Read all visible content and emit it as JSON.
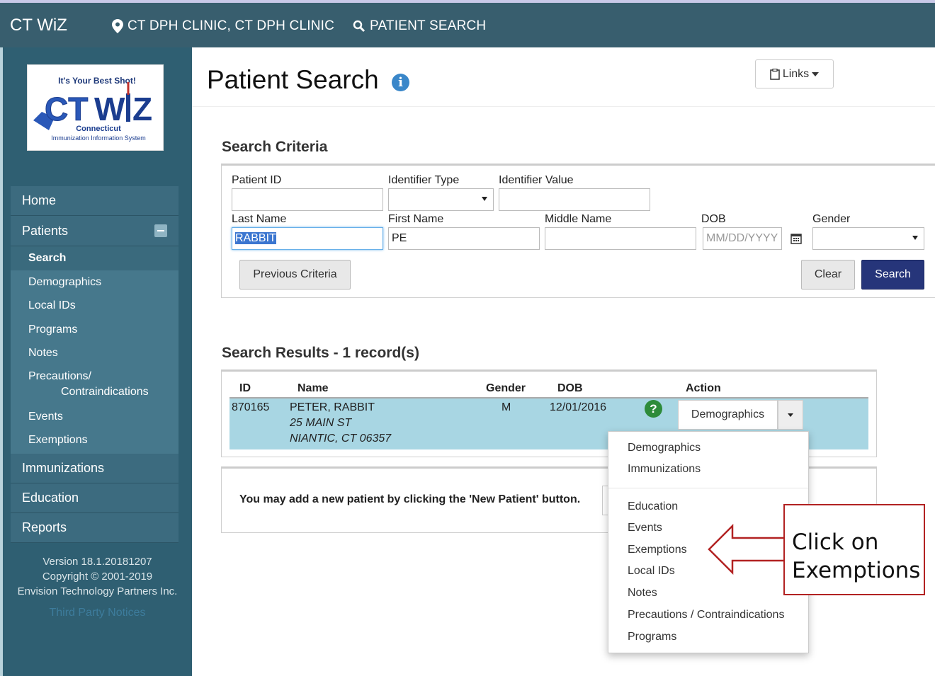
{
  "topbar": {
    "brand": "CT WiZ",
    "clinic": "CT DPH CLINIC, CT DPH CLINIC",
    "page": "PATIENT SEARCH",
    "clinic_icon": "map-marker-icon",
    "page_icon": "search-icon"
  },
  "logo": {
    "tagline": "It's Your Best Shot!",
    "wordmark": "CT WiZ",
    "state": "Connecticut",
    "system": "Immunization Information System"
  },
  "sidebar": {
    "home": "Home",
    "patients": "Patients",
    "patient_items": [
      "Search",
      "Demographics",
      "Local IDs",
      "Programs",
      "Notes"
    ],
    "precautions_line1": "Precautions/",
    "precautions_line2": "Contraindications",
    "patient_items_2": [
      "Events",
      "Exemptions"
    ],
    "immunizations": "Immunizations",
    "education": "Education",
    "reports": "Reports",
    "version": "Version 18.1.20181207",
    "copyright": "Copyright © 2001-2019",
    "company": "Envision Technology Partners Inc.",
    "third_party": "Third Party Notices"
  },
  "header": {
    "title": "Patient Search",
    "links_label": "Links"
  },
  "criteria": {
    "title": "Search Criteria",
    "patient_id_label": "Patient ID",
    "identifier_type_label": "Identifier Type",
    "identifier_value_label": "Identifier Value",
    "last_name_label": "Last Name",
    "first_name_label": "First Name",
    "middle_name_label": "Middle Name",
    "dob_label": "DOB",
    "gender_label": "Gender",
    "last_name_value": "RABBIT",
    "first_name_value": "PE",
    "dob_placeholder": "MM/DD/YYYY",
    "previous_button": "Previous Criteria",
    "clear_button": "Clear",
    "search_button": "Search"
  },
  "results": {
    "title": "Search Results - 1 record(s)",
    "headers": {
      "id": "ID",
      "name": "Name",
      "gender": "Gender",
      "dob": "DOB",
      "action": "Action"
    },
    "row": {
      "id": "870165",
      "name": "PETER, RABBIT",
      "address1": "25 MAIN ST",
      "address2": "NIANTIC, CT 06357",
      "gender": "M",
      "dob": "12/01/2016",
      "action": "Demographics"
    }
  },
  "new_patient": {
    "text": "You may add a new patient by clicking the 'New Patient' button."
  },
  "dropdown": {
    "group1": [
      "Demographics",
      "Immunizations"
    ],
    "group2": [
      "Education",
      "Events",
      "Exemptions",
      "Local IDs",
      "Notes",
      "Precautions / Contraindications",
      "Programs"
    ]
  },
  "callout": {
    "line1": "Click on",
    "line2": "Exemptions"
  },
  "colors": {
    "topbar": "#385e6e",
    "sidebar": "#2f5f72",
    "primary_button": "#26357a",
    "selected_row": "#a8d6e3",
    "callout_border": "#b22222"
  }
}
